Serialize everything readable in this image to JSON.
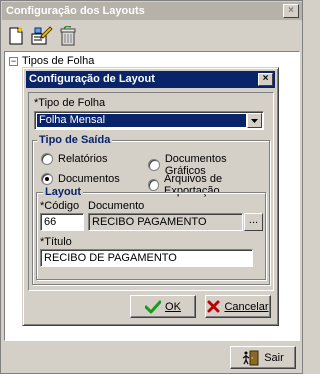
{
  "outer_window": {
    "title": "Configuração dos Layouts",
    "close_glyph": "×"
  },
  "toolbar": {
    "buttons": [
      {
        "name": "new-document-icon"
      },
      {
        "name": "edit-icon"
      },
      {
        "name": "trash-icon"
      }
    ]
  },
  "tree": {
    "expander": "−",
    "root_label": "Tipos de Folha"
  },
  "dialog": {
    "title": "Configuração de Layout",
    "close_glyph": "×",
    "tipo_folha_label": "*Tipo de Folha",
    "tipo_folha_value": "Folha Mensal",
    "tipo_saida": {
      "title": "Tipo de Saída",
      "options": [
        {
          "label": "Relatórios",
          "selected": false
        },
        {
          "label": "Documentos Gráficos",
          "selected": false
        },
        {
          "label": "Documentos",
          "selected": true
        },
        {
          "label": "Arquivos de Exportação",
          "selected": false
        }
      ]
    },
    "layout": {
      "title": "Layout",
      "codigo_label": "*Código",
      "codigo_value": "66",
      "documento_label": "Documento",
      "documento_value": "RECIBO PAGAMENTO",
      "ellipsis": "...",
      "titulo_label": "*Título",
      "titulo_value": "RECIBO DE PAGAMENTO"
    },
    "ok_label": "OK",
    "cancel_label": "Cancelar"
  },
  "bottom": {
    "sair_label": "Sair"
  },
  "colors": {
    "titlebar_active": "#0a246a",
    "titlebar_inactive": "#b6b2aa",
    "window_bg": "#d4d0c8",
    "ok_check": "#1a9a1a",
    "cancel_x": "#c00000"
  }
}
